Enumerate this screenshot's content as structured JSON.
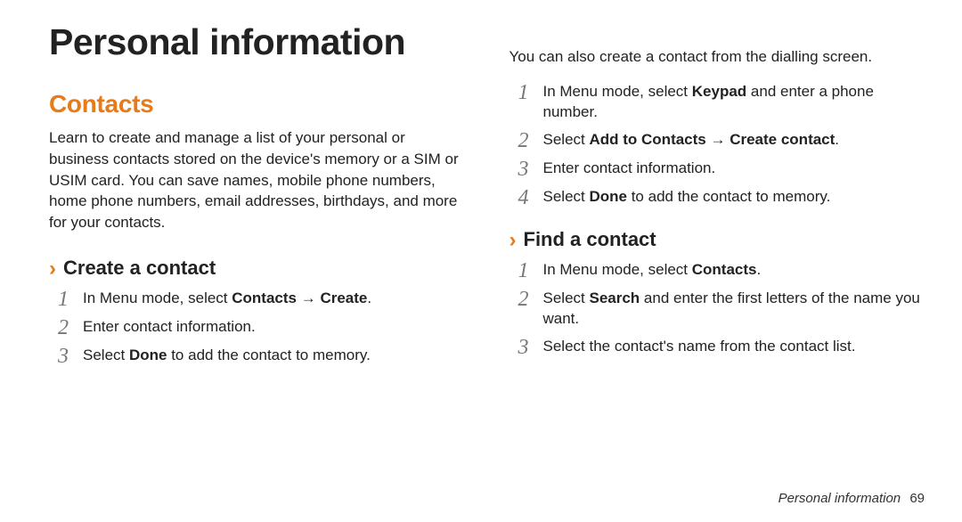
{
  "heading": "Personal information",
  "section": {
    "title": "Contacts",
    "intro": "Learn to create and manage a list of your personal or business contacts stored on the device's memory or a SIM or USIM card. You can save names, mobile phone numbers, home phone numbers, email addresses, birthdays, and more for your contacts."
  },
  "sub1": {
    "title": "Create a contact",
    "steps": [
      {
        "num": "1",
        "pre": "In Menu mode, select ",
        "bold": "Contacts → Create",
        "post": "."
      },
      {
        "num": "2",
        "pre": "Enter contact information.",
        "bold": "",
        "post": ""
      },
      {
        "num": "3",
        "pre": "Select ",
        "bold": "Done",
        "post": " to add the contact to memory."
      }
    ]
  },
  "right": {
    "lead": "You can also create a contact from the dialling screen.",
    "stepsA": [
      {
        "num": "1",
        "pre": "In Menu mode, select ",
        "bold": "Keypad",
        "post": " and enter a phone number."
      },
      {
        "num": "2",
        "pre": "Select ",
        "bold": "Add to Contacts → Create contact",
        "post": "."
      },
      {
        "num": "3",
        "pre": "Enter contact information.",
        "bold": "",
        "post": ""
      },
      {
        "num": "4",
        "pre": "Select ",
        "bold": "Done",
        "post": " to add the contact to memory."
      }
    ],
    "sub2": {
      "title": "Find a contact",
      "steps": [
        {
          "num": "1",
          "pre": "In Menu mode, select ",
          "bold": "Contacts",
          "post": "."
        },
        {
          "num": "2",
          "pre": "Select ",
          "bold": "Search",
          "post": " and enter the first letters of the name you want."
        },
        {
          "num": "3",
          "pre": "Select the contact's name from the contact list.",
          "bold": "",
          "post": ""
        }
      ]
    }
  },
  "footer": {
    "label": "Personal information",
    "page": "69"
  },
  "chevron": "›"
}
